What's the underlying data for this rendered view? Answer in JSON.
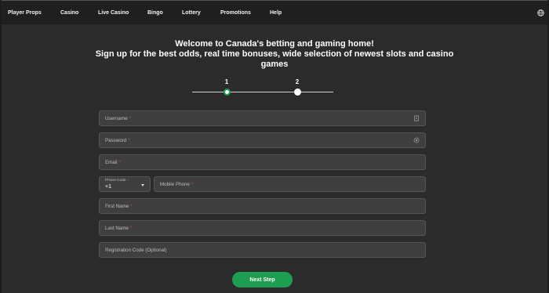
{
  "nav": {
    "items": [
      "Player Props",
      "Casino",
      "Live Casino",
      "Bingo",
      "Lottery",
      "Promotions",
      "Help"
    ],
    "right_icon": "globe-icon"
  },
  "header": {
    "line1": "Welcome to Canada's betting and gaming home!",
    "line2": "Sign up for the best odds, real time bonuses, wide selection of newest slots and casino",
    "line3": "games"
  },
  "stepper": {
    "step1": "1",
    "step2": "2",
    "active_step": 1,
    "active_color": "#1e9e50"
  },
  "form": {
    "username": {
      "label": "Username",
      "required": "*",
      "icon": "id-card-icon"
    },
    "password": {
      "label": "Password",
      "required": "*",
      "icon": "eye-icon"
    },
    "email": {
      "label": "Email",
      "required": "*"
    },
    "phone_code": {
      "label": "Phone Code",
      "required": "*",
      "value": "+1"
    },
    "mobile_phone": {
      "label": "Mobile Phone",
      "required": "*"
    },
    "first_name": {
      "label": "First Name",
      "required": "*"
    },
    "last_name": {
      "label": "Last Name",
      "required": "*"
    },
    "registration_code": {
      "label": "Registration Code (Optional)"
    },
    "next_button": "Next Step"
  },
  "colors": {
    "accent": "#1e9e50",
    "background": "#2b2b2b",
    "nav_background": "#1f1f1f",
    "field_background": "#3f3f3f",
    "required": "#c8464a"
  }
}
